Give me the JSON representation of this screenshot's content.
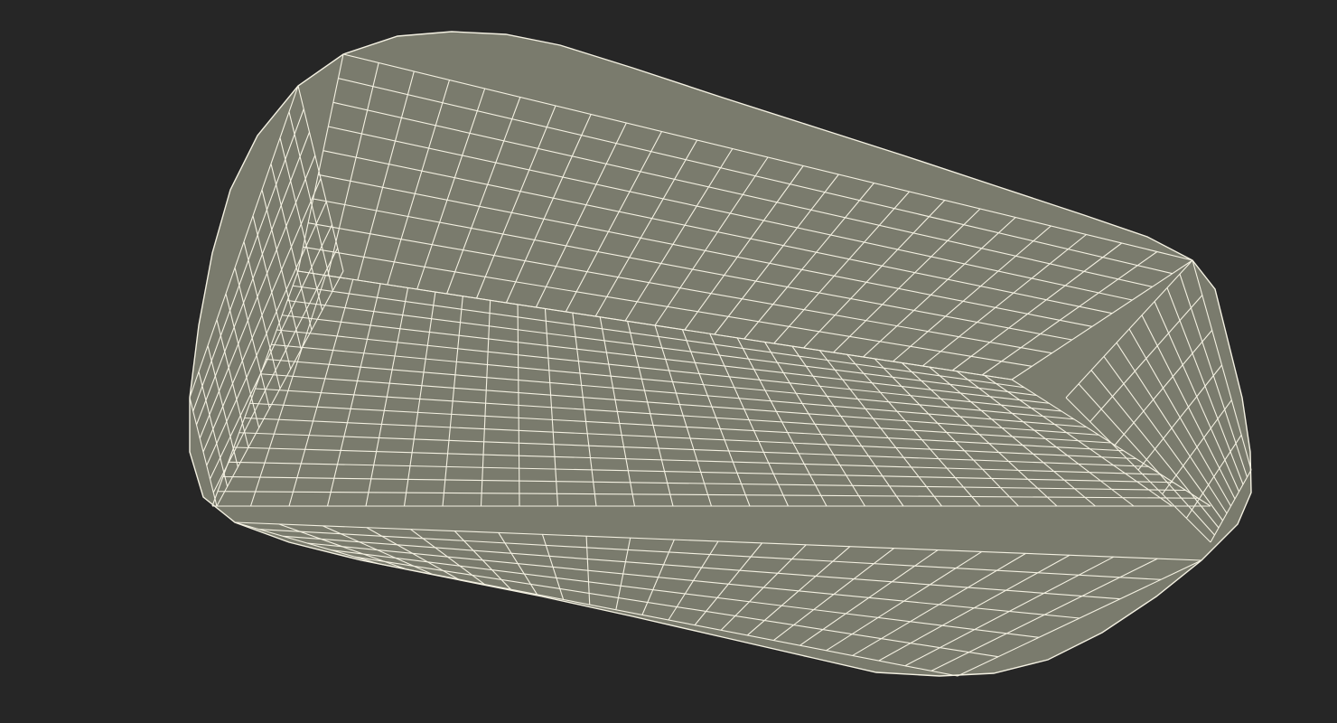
{
  "scene": {
    "background_color": "#262626",
    "mesh_fill_color": "#7a7b6d",
    "wire_color": "#f4f1e2",
    "render_mode": "wireframe-on-shaded",
    "object": "rounded-box"
  }
}
